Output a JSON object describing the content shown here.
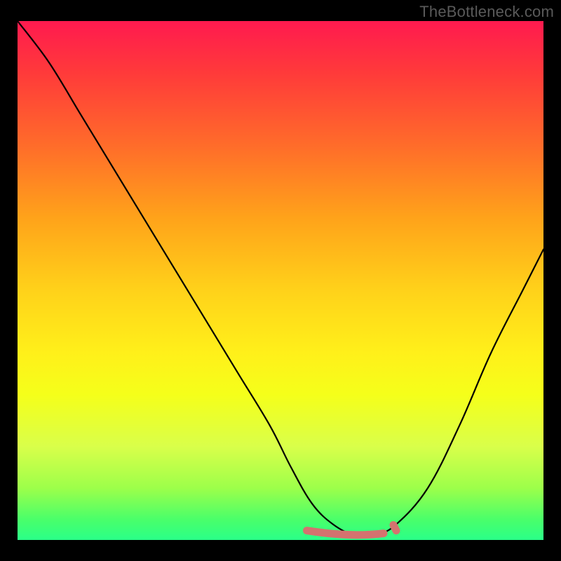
{
  "watermark": "TheBottleneck.com",
  "colors": {
    "background": "#000000",
    "gradient_top": "#ff1a4f",
    "gradient_bottom": "#2aff88",
    "curve": "#000000",
    "flat_marker": "#d4726f",
    "watermark": "#5a5a5a"
  },
  "chart_data": {
    "type": "line",
    "title": "",
    "xlabel": "",
    "ylabel": "",
    "xlim": [
      0,
      1
    ],
    "ylim": [
      0,
      1
    ],
    "series": [
      {
        "name": "bottleneck-curve",
        "x": [
          0.0,
          0.06,
          0.12,
          0.18,
          0.24,
          0.3,
          0.36,
          0.42,
          0.48,
          0.52,
          0.56,
          0.6,
          0.64,
          0.68,
          0.72,
          0.78,
          0.84,
          0.9,
          0.96,
          1.0
        ],
        "values": [
          1.0,
          0.92,
          0.82,
          0.72,
          0.62,
          0.52,
          0.42,
          0.32,
          0.22,
          0.14,
          0.07,
          0.03,
          0.01,
          0.01,
          0.03,
          0.1,
          0.22,
          0.36,
          0.48,
          0.56
        ]
      }
    ],
    "annotations": [
      {
        "name": "flat-minimum-marker",
        "x_start": 0.55,
        "x_end": 0.72,
        "y": 0.01
      }
    ]
  }
}
